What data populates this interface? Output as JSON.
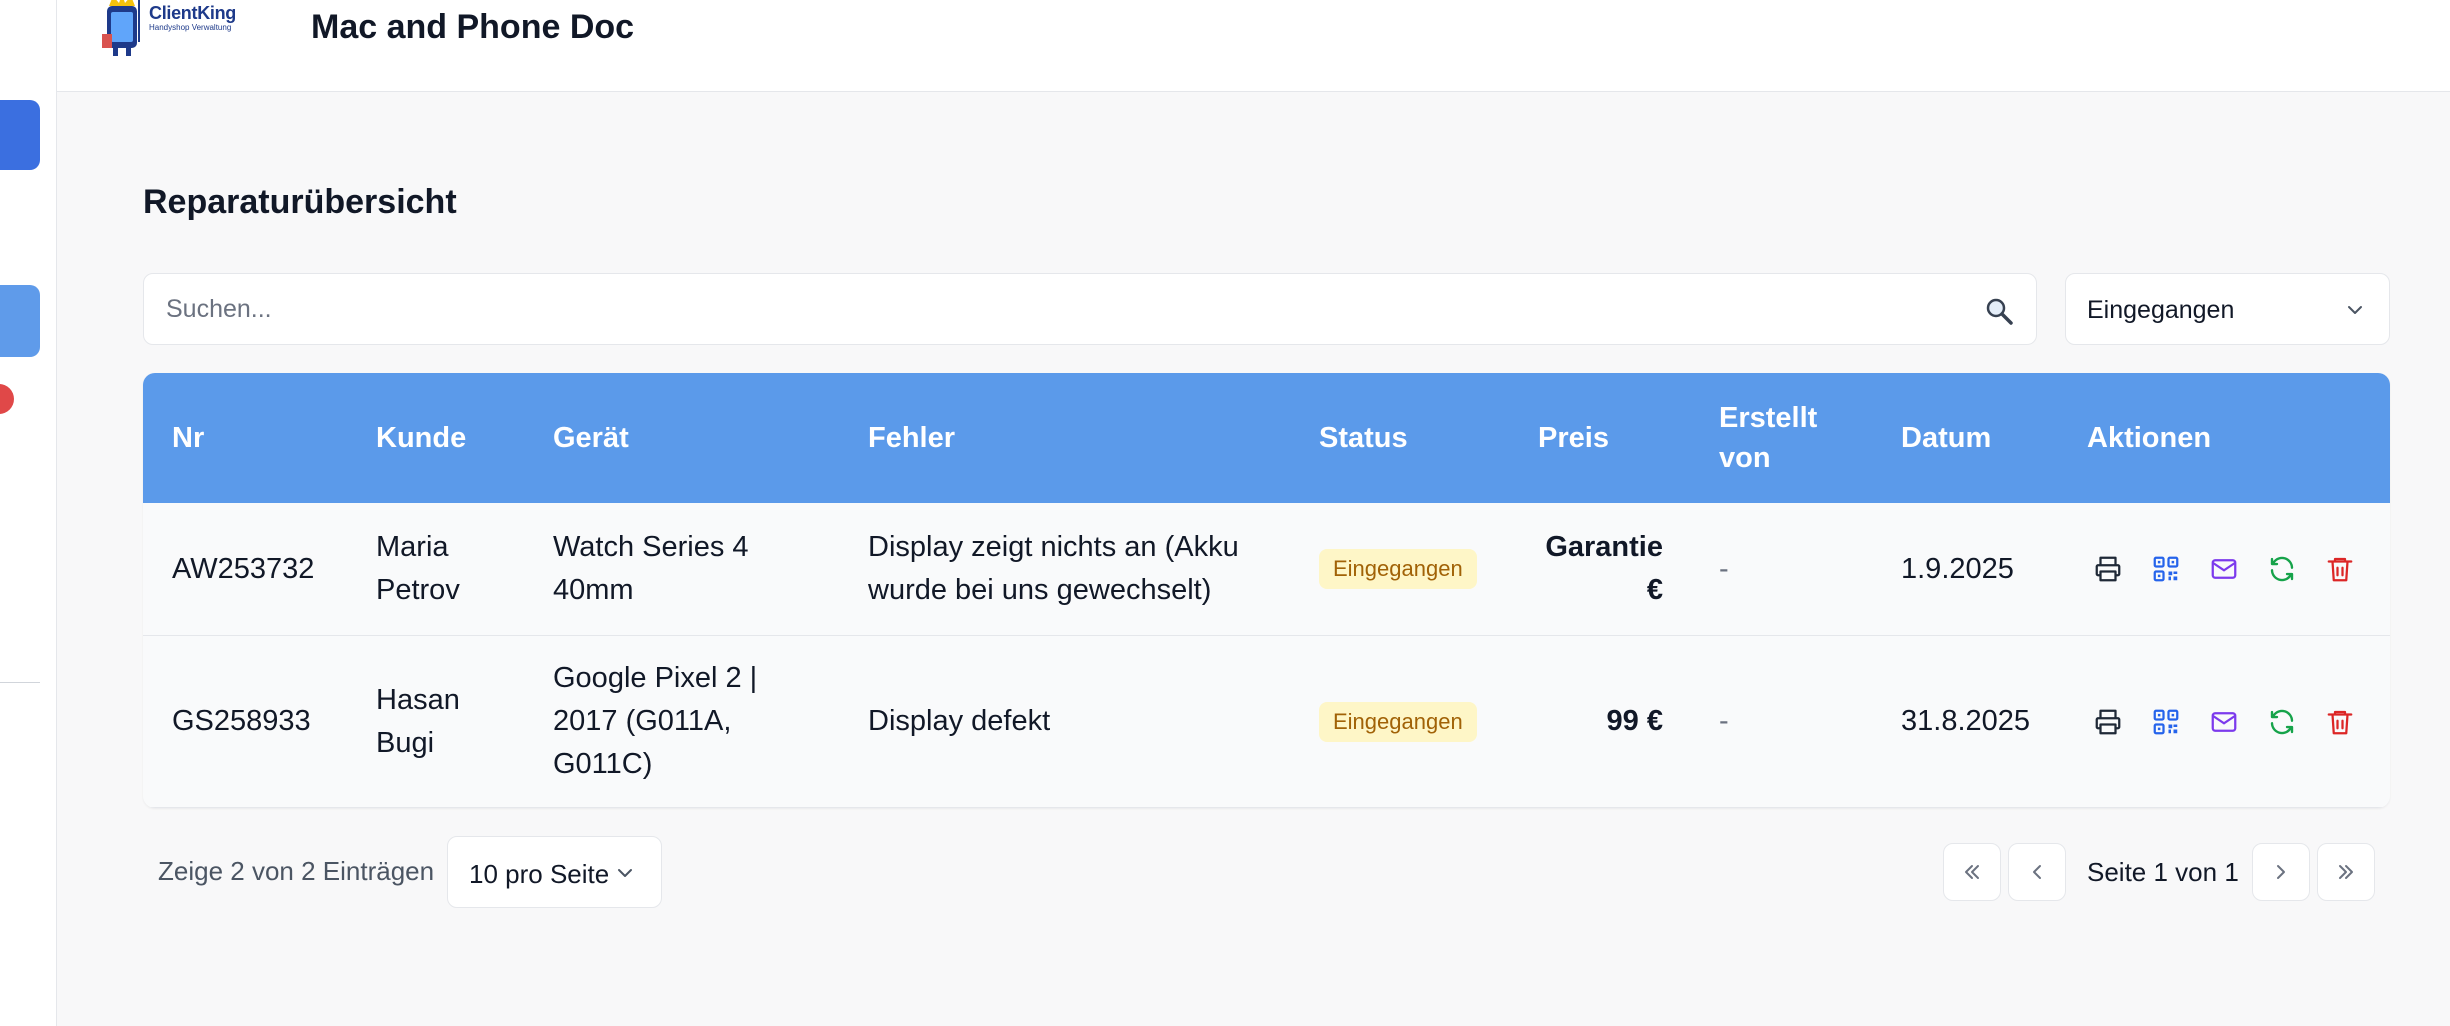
{
  "header": {
    "logo_title": "ClientKing",
    "logo_subtitle": "Handyshop Verwaltung",
    "app_title": "Mac and Phone Doc"
  },
  "page": {
    "title": "Reparaturübersicht"
  },
  "search": {
    "placeholder": "Suchen..."
  },
  "status_filter": {
    "selected": "Eingegangen"
  },
  "table": {
    "columns": [
      "Nr",
      "Kunde",
      "Gerät",
      "Fehler",
      "Status",
      "Preis",
      "Erstellt von",
      "Datum",
      "Aktionen"
    ],
    "rows": [
      {
        "nr": "AW253732",
        "kunde": "Maria Petrov",
        "geraet": "Watch Series 4 40mm",
        "fehler": "Display zeigt nichts an (Akku wurde bei uns gewechselt)",
        "status": "Eingegangen",
        "preis": "Garantie €",
        "erstellt_von": "-",
        "datum": "1.9.2025"
      },
      {
        "nr": "GS258933",
        "kunde": "Hasan Bugi",
        "geraet": "Google Pixel 2 | 2017 (G011A, G011C)",
        "fehler": "Display defekt",
        "status": "Eingegangen",
        "preis": "99 €",
        "erstellt_von": "-",
        "datum": "31.8.2025"
      }
    ]
  },
  "footer": {
    "entries_text": "Zeige 2 von 2 Einträgen",
    "per_page": "10 pro Seite",
    "page_text": "Seite 1 von 1"
  },
  "colors": {
    "header_blue": "#5b9aea",
    "badge_bg": "#fef6c7",
    "badge_text": "#a16207",
    "qr_icon": "#2563eb",
    "mail_icon": "#7c3aed",
    "refresh_icon": "#16a34a",
    "delete_icon": "#dc2626"
  },
  "icons": {
    "actions": [
      "printer-icon",
      "qr-code-icon",
      "mail-icon",
      "refresh-icon",
      "trash-icon"
    ]
  }
}
